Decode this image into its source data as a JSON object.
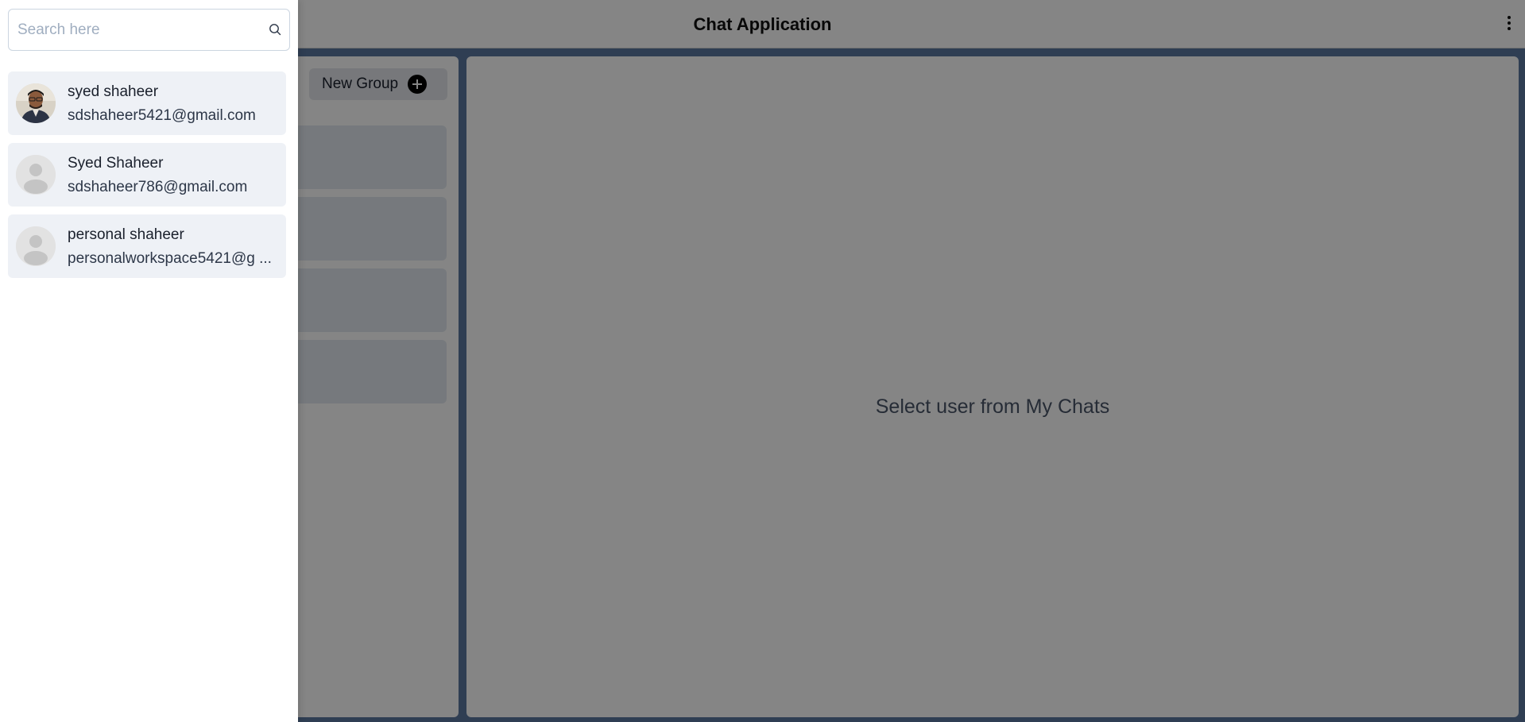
{
  "header": {
    "title": "Chat Application"
  },
  "my_chats": {
    "new_group_label": "New Group",
    "item_count": 4
  },
  "chat_box": {
    "empty_message": "Select user from My Chats"
  },
  "drawer": {
    "search": {
      "placeholder": "Search here",
      "value": ""
    },
    "results": [
      {
        "name": "syed shaheer",
        "email": "sdshaheer5421@gmail.com",
        "avatar": "photo"
      },
      {
        "name": "Syed Shaheer",
        "email": "sdshaheer786@gmail.com",
        "avatar": "default-user-icon"
      },
      {
        "name": "personal shaheer",
        "email": "personalworkspace5421@g ...",
        "avatar": "default-user-icon"
      }
    ]
  }
}
